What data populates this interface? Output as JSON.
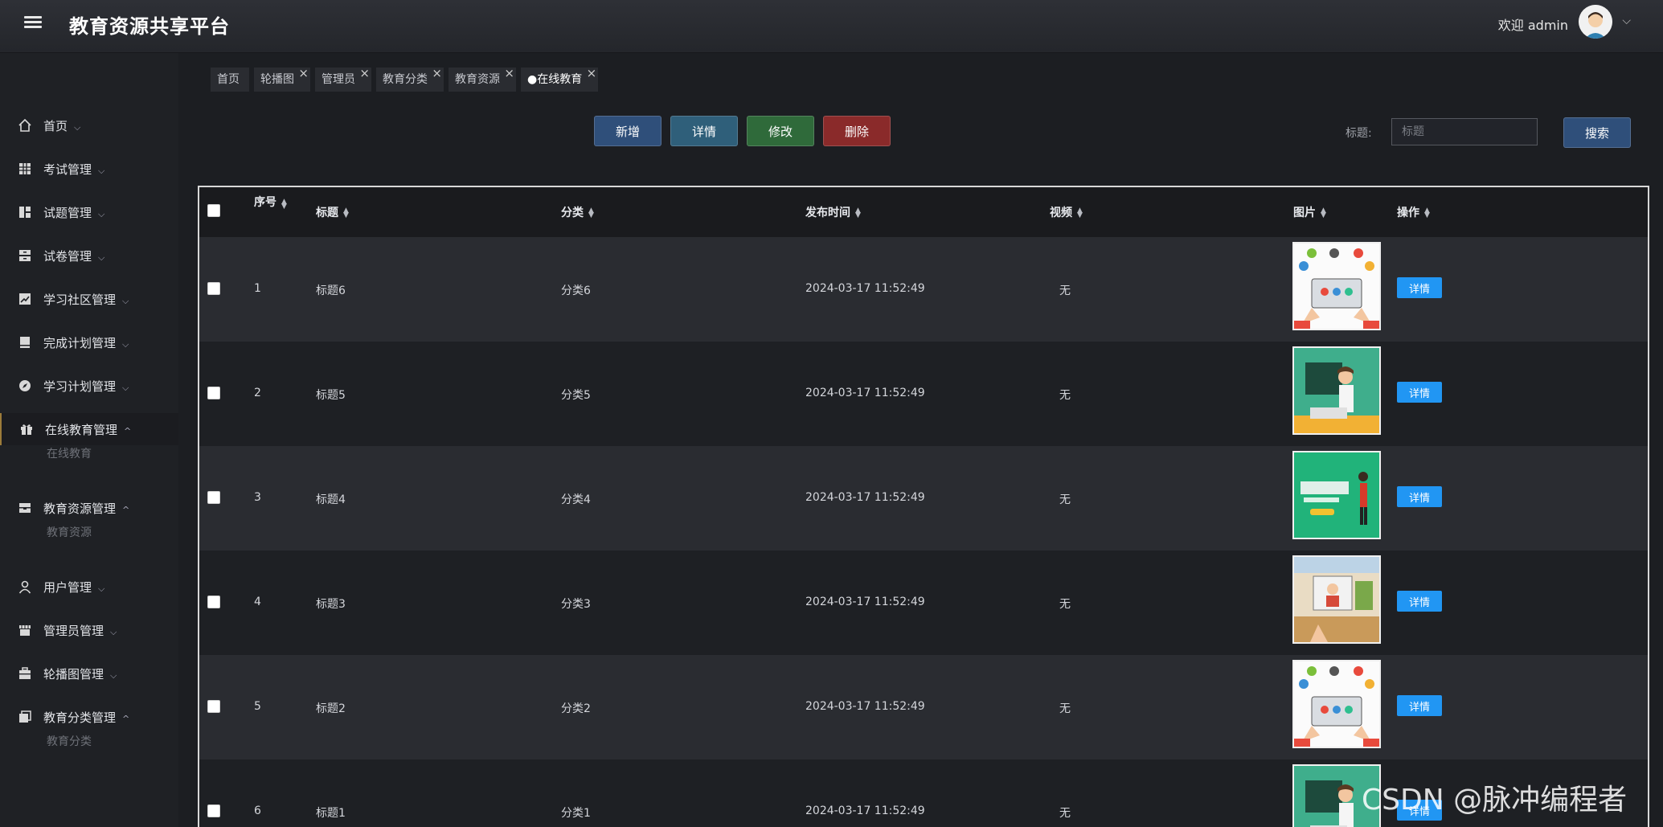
{
  "header": {
    "title": "教育资源共享平台",
    "welcome": "欢迎 admin"
  },
  "sidebar": {
    "items": [
      {
        "label": "首页",
        "icon": "home-icon",
        "caret": "⌵"
      },
      {
        "label": "考试管理",
        "icon": "grid-icon",
        "caret": "⌵"
      },
      {
        "label": "试题管理",
        "icon": "layout-icon",
        "caret": "⌵"
      },
      {
        "label": "试卷管理",
        "icon": "archive-icon",
        "caret": "⌵"
      },
      {
        "label": "学习社区管理",
        "icon": "chart-icon",
        "caret": "⌵"
      },
      {
        "label": "完成计划管理",
        "icon": "book-icon",
        "caret": "⌵"
      },
      {
        "label": "学习计划管理",
        "icon": "compass-icon",
        "caret": "⌵"
      },
      {
        "label": "在线教育管理",
        "icon": "gift-icon",
        "caret": "^"
      },
      {
        "label": "教育资源管理",
        "icon": "inbox-icon",
        "caret": "^"
      },
      {
        "label": "用户管理",
        "icon": "user-icon",
        "caret": "⌵"
      },
      {
        "label": "管理员管理",
        "icon": "store-icon",
        "caret": "⌵"
      },
      {
        "label": "轮播图管理",
        "icon": "briefcase-icon",
        "caret": "⌵"
      },
      {
        "label": "教育分类管理",
        "icon": "layers-icon",
        "caret": "^"
      }
    ],
    "subs": [
      "在线教育",
      "教育资源",
      "教育分类"
    ]
  },
  "tabs": [
    {
      "label": "首页"
    },
    {
      "label": "轮播图"
    },
    {
      "label": "管理员"
    },
    {
      "label": "教育分类"
    },
    {
      "label": "教育资源"
    },
    {
      "label": "●在线教育"
    }
  ],
  "toolbar": {
    "add": "新增",
    "detail": "详情",
    "edit": "修改",
    "delete": "删除",
    "search_label": "标题:",
    "search_placeholder": "标题",
    "search_button": "搜索",
    "colors": {
      "add": "#2f4f7a",
      "detail": "#2f5f7a",
      "edit": "#2f6a3a",
      "delete": "#8a2a2a",
      "search": "#2f4f7a"
    }
  },
  "table": {
    "columns": [
      "序号",
      "标题",
      "分类",
      "发布时间",
      "视频",
      "图片",
      "操作"
    ],
    "rows": [
      {
        "index": "1",
        "title": "标题6",
        "category": "分类6",
        "time": "2024-03-17 11:52:49",
        "video": "无",
        "image": "e-learning",
        "action": "详情"
      },
      {
        "index": "2",
        "title": "标题5",
        "category": "分类5",
        "time": "2024-03-17 11:52:49",
        "video": "无",
        "image": "teacher-board",
        "action": "详情"
      },
      {
        "index": "3",
        "title": "标题4",
        "category": "分类4",
        "time": "2024-03-17 11:52:49",
        "video": "无",
        "image": "study-green",
        "action": "详情"
      },
      {
        "index": "4",
        "title": "标题3",
        "category": "分类3",
        "time": "2024-03-17 11:52:49",
        "video": "无",
        "image": "online-class",
        "action": "详情"
      },
      {
        "index": "5",
        "title": "标题2",
        "category": "分类2",
        "time": "2024-03-17 11:52:49",
        "video": "无",
        "image": "e-learning",
        "action": "详情"
      },
      {
        "index": "6",
        "title": "标题1",
        "category": "分类1",
        "time": "2024-03-17 11:52:49",
        "video": "无",
        "image": "teacher-board",
        "action": "详情"
      }
    ]
  },
  "watermark": "CSDN @脉冲编程者"
}
